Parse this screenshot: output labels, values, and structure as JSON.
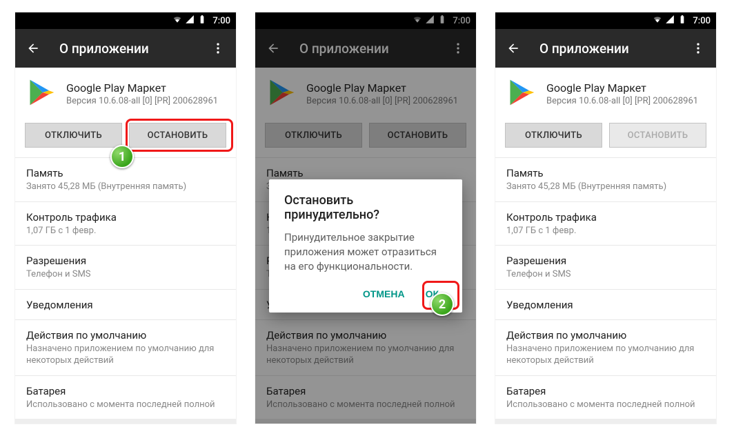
{
  "statusbar": {
    "time": "7:00"
  },
  "actionbar": {
    "title": "О приложении"
  },
  "app": {
    "name": "Google Play Маркет",
    "version": "Версия 10.6.08-all [0] [PR] 200628961"
  },
  "buttons": {
    "disable": "ОТКЛЮЧИТЬ",
    "stop": "ОСТАНОВИТЬ"
  },
  "sections": {
    "memory": {
      "title": "Память",
      "sub": "Занято 45,28  МБ (Внутренняя память)"
    },
    "data": {
      "title": "Контроль трафика",
      "sub": "1,07  ГБ с 1 февр."
    },
    "perm": {
      "title": "Разрешения",
      "sub": "Телефон и SMS"
    },
    "notif": {
      "title": "Уведомления",
      "sub": ""
    },
    "defaults": {
      "title": "Действия по умолчанию",
      "sub": "Назначено приложением по умолчанию для некоторых действий"
    },
    "battery": {
      "title": "Батарея",
      "sub": "Использовано с момента последней полной"
    }
  },
  "dialog": {
    "title": "Остановить принудительно?",
    "body": "Принудительное закрытие приложения может отразиться на его функциональности.",
    "cancel": "ОТМЕНА",
    "ok": "ОК"
  },
  "steps": {
    "one": "1",
    "two": "2"
  }
}
